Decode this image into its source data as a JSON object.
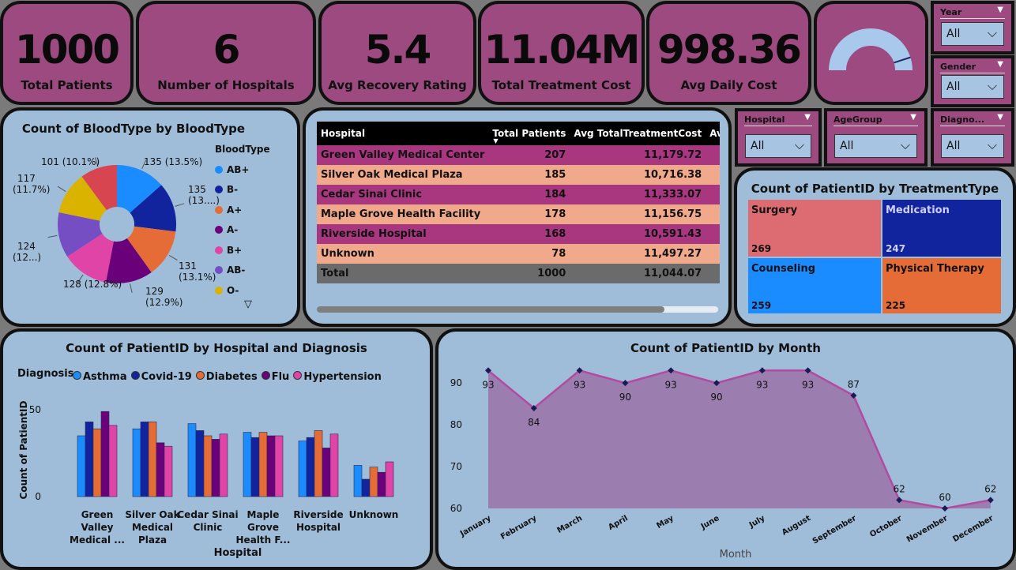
{
  "kpis": [
    {
      "value": "1000",
      "label": "Total Patients"
    },
    {
      "value": "6",
      "label": "Number of Hospitals"
    },
    {
      "value": "5.4",
      "label": "Avg Recovery Rating"
    },
    {
      "value": "11.04M",
      "label": "Total Treatment Cost"
    },
    {
      "value": "998.36",
      "label": "Avg Daily Cost"
    }
  ],
  "gauge": {
    "fraction": 0.9
  },
  "slicers": {
    "year": {
      "title": "Year",
      "value": "All"
    },
    "gender": {
      "title": "Gender",
      "value": "All"
    },
    "hospital": {
      "title": "Hospital",
      "value": "All"
    },
    "agegroup": {
      "title": "AgeGroup",
      "value": "All"
    },
    "diagnosis": {
      "title": "Diagno...",
      "value": "All"
    }
  },
  "blood": {
    "title": "Count of BloodType by BloodType",
    "legend_title": "BloodType",
    "chart_data": {
      "type": "pie",
      "categories": [
        "AB+",
        "B-",
        "A+",
        "A-",
        "B+",
        "AB-",
        "O-",
        "O+"
      ],
      "values": [
        135,
        135,
        131,
        129,
        128,
        124,
        117,
        101
      ],
      "labels": [
        "135 (13.5%)",
        "135 (13....)",
        "131 (13.1%)",
        "129 (12.9%)",
        "128 (12.8%)",
        "124 (12...)",
        "117 (11.7%)",
        "101 (10.1%)"
      ],
      "colors": [
        "#1a8cff",
        "#12239e",
        "#e66c37",
        "#6b007b",
        "#e044a7",
        "#744ec2",
        "#d9b300",
        "#d64550"
      ]
    }
  },
  "table": {
    "headers": [
      "Hospital",
      "Total Patients",
      "Avg TotalTreatmentCost",
      "Avg Reco"
    ],
    "rows": [
      [
        "Green Valley Medical Center",
        "207",
        "11,179.72"
      ],
      [
        "Silver Oak Medical Plaza",
        "185",
        "10,716.38"
      ],
      [
        "Cedar Sinai Clinic",
        "184",
        "11,333.07"
      ],
      [
        "Maple Grove Health Facility",
        "178",
        "11,156.75"
      ],
      [
        "Riverside Hospital",
        "168",
        "10,591.43"
      ],
      [
        "Unknown",
        "78",
        "11,497.27"
      ]
    ],
    "total": [
      "Total",
      "1000",
      "11,044.07"
    ]
  },
  "treemap": {
    "title": "Count of PatientID by TreatmentType",
    "chart_data": {
      "type": "treemap",
      "categories": [
        "Surgery",
        "Medication",
        "Counseling",
        "Physical Therapy"
      ],
      "values": [
        269,
        247,
        259,
        225
      ],
      "colors": [
        "#dd6b72",
        "#12239e",
        "#1a8cff",
        "#e66c37"
      ]
    },
    "labels": [
      "Surgery",
      "Medication",
      "Counseling",
      "Physical Therapy"
    ],
    "counts": [
      "269",
      "247",
      "259",
      "225"
    ]
  },
  "bars": {
    "title": "Count of PatientID by Hospital and Diagnosis",
    "legend_title": "Diagnosis",
    "ylabel": "Count of PatientID",
    "xlabel": "Hospital",
    "ticks": [
      "50",
      "0"
    ],
    "chart_data": {
      "type": "bar",
      "categories": [
        "Green Valley Medical ...",
        "Silver Oak Medical Plaza",
        "Cedar Sinai Clinic",
        "Maple Grove Health F...",
        "Riverside Hospital",
        "Unknown"
      ],
      "ylim": [
        0,
        50
      ],
      "series": [
        {
          "name": "Asthma",
          "color": "#1a8cff",
          "values": [
            35,
            39,
            42,
            37,
            32,
            18
          ]
        },
        {
          "name": "Covid-19",
          "color": "#12239e",
          "values": [
            43,
            43,
            38,
            34,
            34,
            10
          ]
        },
        {
          "name": "Diabetes",
          "color": "#e66c37",
          "values": [
            39,
            43,
            35,
            37,
            38,
            17
          ]
        },
        {
          "name": "Flu",
          "color": "#6b007b",
          "values": [
            49,
            31,
            33,
            35,
            28,
            14
          ]
        },
        {
          "name": "Hypertension",
          "color": "#e044a7",
          "values": [
            41,
            29,
            36,
            35,
            36,
            20
          ]
        }
      ]
    },
    "cat_lines": [
      [
        "Green",
        "Valley",
        "Medical ..."
      ],
      [
        "Silver Oak",
        "Medical",
        "Plaza"
      ],
      [
        "Cedar Sinai",
        "Clinic"
      ],
      [
        "Maple",
        "Grove",
        "Health F..."
      ],
      [
        "Riverside",
        "Hospital"
      ],
      [
        "Unknown"
      ]
    ]
  },
  "line": {
    "title": "Count of PatientID by Month",
    "xlabel": "Month",
    "yticks": [
      "90",
      "80",
      "70",
      "60"
    ],
    "chart_data": {
      "type": "area",
      "x": [
        "January",
        "February",
        "March",
        "April",
        "May",
        "June",
        "July",
        "August",
        "September",
        "October",
        "November",
        "December"
      ],
      "values": [
        93,
        84,
        93,
        90,
        93,
        90,
        93,
        93,
        87,
        62,
        60,
        62
      ],
      "ylim": [
        60,
        94
      ]
    }
  }
}
